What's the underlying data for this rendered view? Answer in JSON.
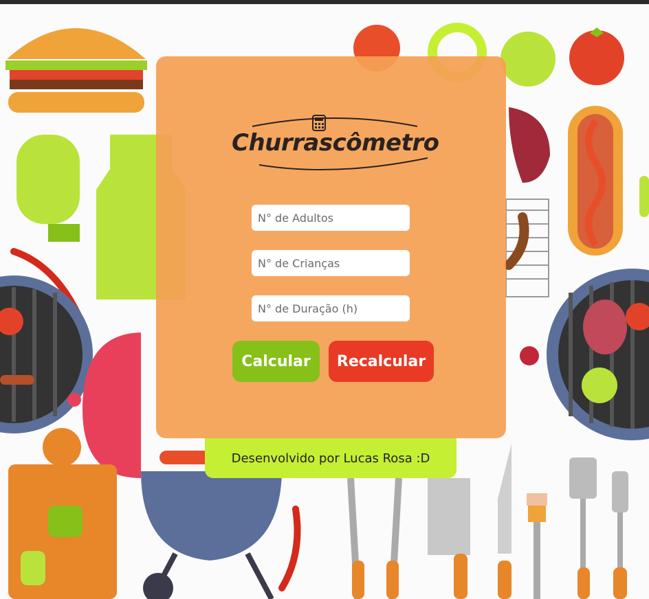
{
  "app": {
    "logo_text": "Churrascômetro"
  },
  "form": {
    "adults_placeholder": "N° de Adultos",
    "children_placeholder": "N° de Crianças",
    "duration_placeholder": "N° de Duração (h)",
    "calculate_label": "Calcular",
    "recalculate_label": "Recalcular"
  },
  "footer": {
    "credit": "Desenvolvido por Lucas Rosa :D"
  },
  "colors": {
    "card": "#f4a054",
    "calculate": "#86c018",
    "recalculate": "#e83a25",
    "footer": "#c5ef33"
  },
  "background_icons": [
    "burger-icon",
    "hotdog-icon",
    "tomato-icon",
    "pepper-icon",
    "grill-icon",
    "mitt-icon",
    "apron-icon",
    "cutting-board-icon",
    "knife-icon",
    "fork-icon",
    "tongs-icon",
    "spatula-icon",
    "steak-icon"
  ]
}
